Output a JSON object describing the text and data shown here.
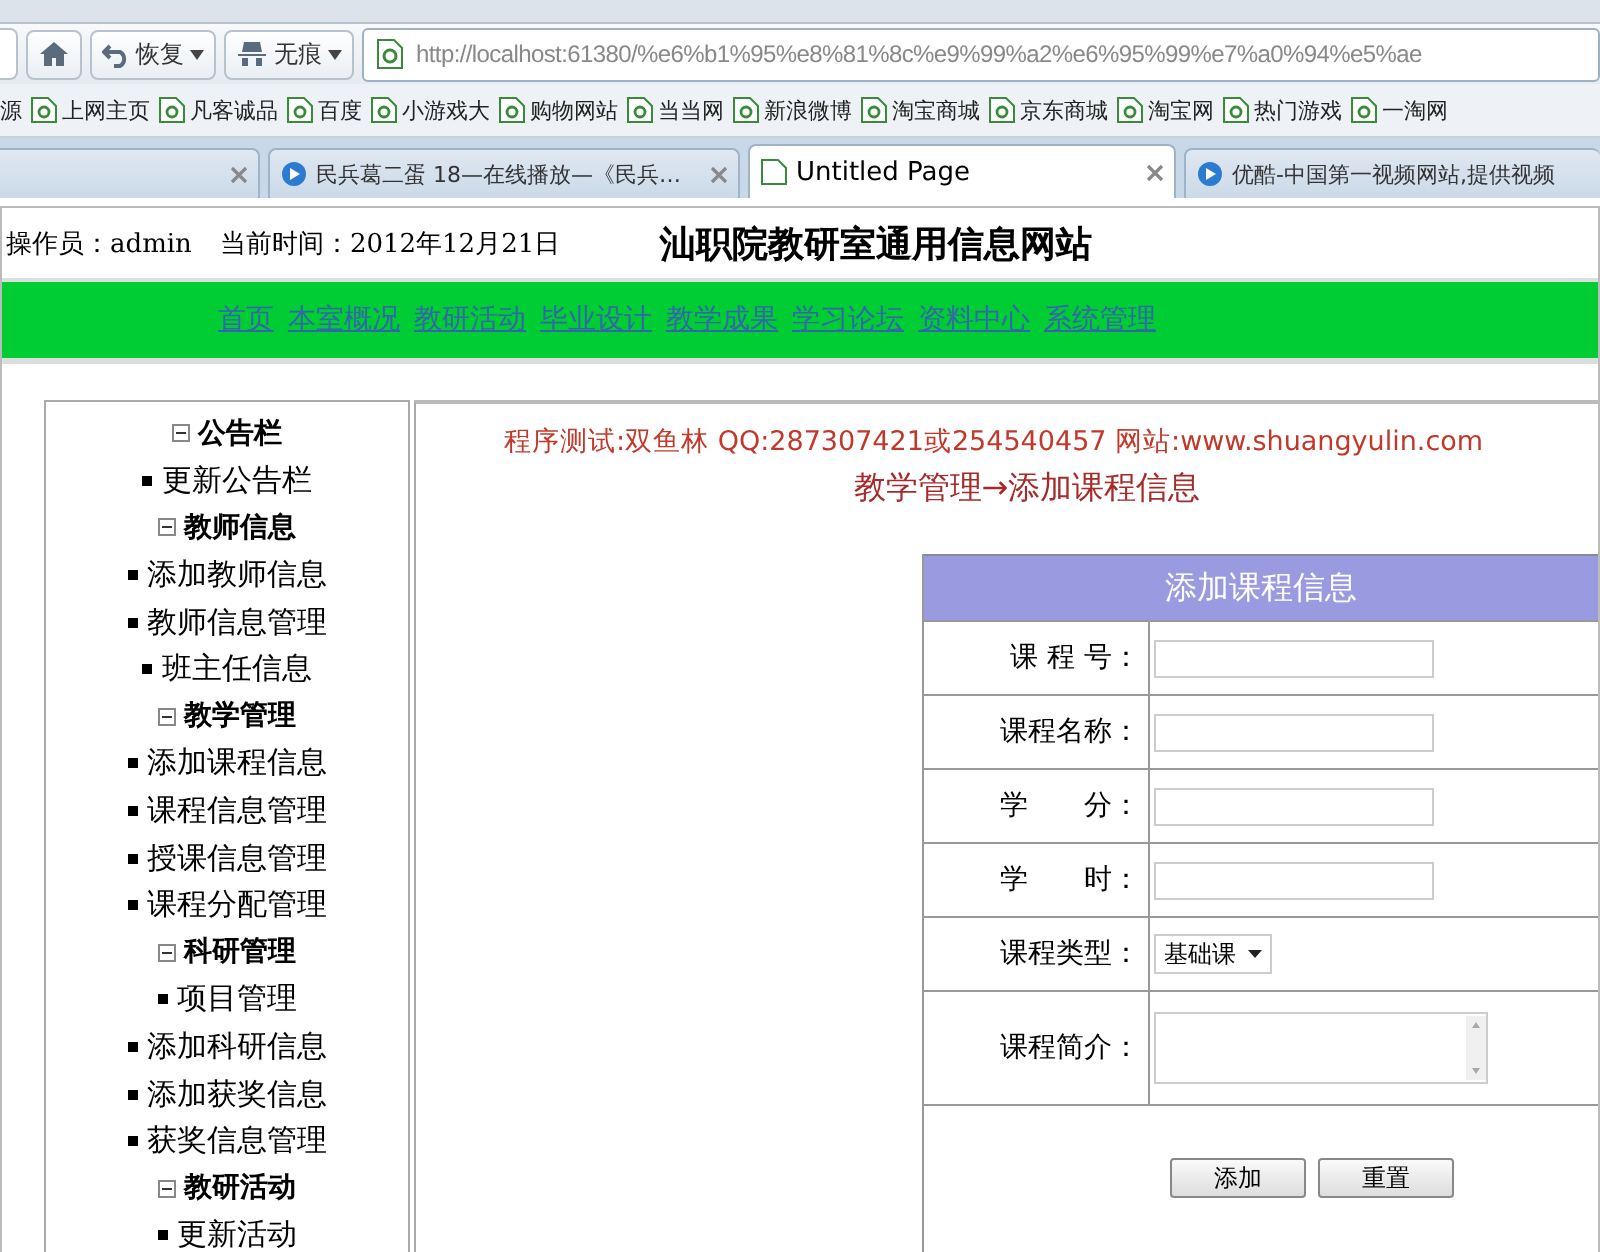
{
  "browser": {
    "nav_buttons": [
      {
        "label": "恢复"
      },
      {
        "label": "无痕"
      }
    ],
    "url": "http://localhost:61380/%e6%b1%95%e8%81%8c%e9%99%a2%e6%95%99%e7%a0%94%e5%ae",
    "bookmarks": [
      {
        "label": "源"
      },
      {
        "label": "上网主页"
      },
      {
        "label": "凡客诚品"
      },
      {
        "label": "百度"
      },
      {
        "label": "小游戏大"
      },
      {
        "label": "购物网站"
      },
      {
        "label": "当当网"
      },
      {
        "label": "新浪微博"
      },
      {
        "label": "淘宝商城"
      },
      {
        "label": "京东商城"
      },
      {
        "label": "淘宝网"
      },
      {
        "label": "热门游戏"
      },
      {
        "label": "一淘网"
      }
    ],
    "tabs": [
      {
        "selected": false
      },
      {
        "title": "民兵葛二蛋 18—在线播放—《民兵…",
        "selected": false
      },
      {
        "title": "Untitled Page",
        "selected": true
      },
      {
        "title": "优酷-中国第一视频网站,提供视频",
        "selected": false
      }
    ]
  },
  "header": {
    "operator": "操作员：admin",
    "date": "当前时间：2012年12月21日",
    "site_title": "汕职院教研室通用信息网站"
  },
  "nav": [
    "首页",
    "本室概况",
    "教研活动",
    "毕业设计",
    "教学成果",
    "学习论坛",
    "资料中心",
    "系统管理"
  ],
  "sidebar": {
    "sections": [
      {
        "label": "公告栏",
        "expanded": true,
        "children": [
          {
            "label": "更新公告栏"
          }
        ]
      },
      {
        "label": "教师信息",
        "expanded": true,
        "children": [
          {
            "label": "添加教师信息"
          },
          {
            "label": "教师信息管理"
          },
          {
            "label": "班主任信息"
          }
        ]
      },
      {
        "label": "教学管理",
        "expanded": true,
        "children": [
          {
            "label": "添加课程信息"
          },
          {
            "label": "课程信息管理"
          },
          {
            "label": "授课信息管理"
          },
          {
            "label": "课程分配管理"
          }
        ]
      },
      {
        "label": "科研管理",
        "expanded": true,
        "children": [
          {
            "label": "项目管理"
          },
          {
            "label": "添加科研信息"
          },
          {
            "label": "添加获奖信息"
          },
          {
            "label": "获奖信息管理"
          }
        ]
      },
      {
        "label": "教研活动",
        "expanded": true,
        "children": [
          {
            "label": "更新活动"
          }
        ]
      }
    ]
  },
  "content": {
    "notice": "程序测试:双鱼林 QQ:287307421或254540457 网站:www.shuangyulin.com",
    "breadcrumb": "教学管理→添加课程信息",
    "form": {
      "title": "添加课程信息",
      "fields": [
        {
          "kind": "text",
          "label": "课 程 号："
        },
        {
          "kind": "text",
          "label": "课程名称："
        },
        {
          "kind": "text",
          "label": "学　　分："
        },
        {
          "kind": "text",
          "label": "学　　时："
        },
        {
          "kind": "select",
          "label": "课程类型：",
          "value": "基础课"
        },
        {
          "kind": "textarea",
          "label": "课程简介："
        }
      ],
      "buttons": [
        "添加",
        "重置"
      ]
    }
  }
}
